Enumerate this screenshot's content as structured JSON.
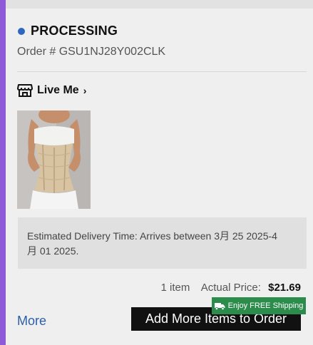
{
  "order": {
    "status": "PROCESSING",
    "status_color": "#2f67c0",
    "order_number": "Order # GSU1NJ28Y002CLK"
  },
  "store": {
    "icon": "store-icon",
    "name": "Live Me",
    "chevron": "›"
  },
  "product": {
    "image_alt": "corset waist trainer product photo"
  },
  "delivery": {
    "text": "Estimated Delivery Time: Arrives between 3月 25 2025-4月 01 2025."
  },
  "summary": {
    "item_count": "1 item",
    "price_label": "Actual Price:",
    "price_value": "$21.69"
  },
  "actions": {
    "more_label": "More",
    "free_shipping_badge": "Enjoy FREE Shipping",
    "add_items_label": "Add More Items to Order"
  },
  "colors": {
    "accent_left": "#8f5ad8",
    "link": "#2d5ea8",
    "badge_green": "#2c8c4c",
    "button_black": "#111111"
  }
}
